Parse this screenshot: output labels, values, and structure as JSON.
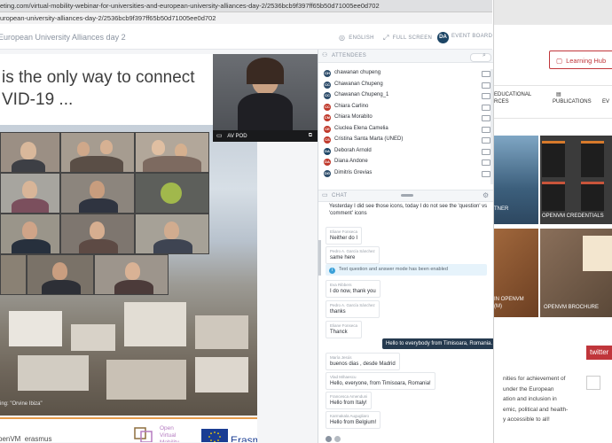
{
  "browser": {
    "url_line1": "eting.com/virtual-mobility-webinar-for-universities-and-european-university-alliances-day-2/2536bcb9f397ff65b50d71005ee0d702",
    "url_line2": "uropean-university-alliances-day-2/2536bcb9f397ff65b50d71005ee0d702"
  },
  "topbar": {
    "event_title": "European University Alliances day 2",
    "english": "ENGLISH",
    "full_screen": "FULL SCREEN",
    "avatar_initials": "DA",
    "event_board": "EVENT BOARD"
  },
  "slide": {
    "title_line1": "is the only way to connect",
    "title_line2": "VID-19 ...",
    "caption": "ing: \"Orvine Ibiza\"",
    "handle": "penVM_erasmus",
    "logo_text": "Open\nVirtual\nMobility",
    "erasmus": "Erasmus+"
  },
  "avpod": {
    "label": "AV POD"
  },
  "attendees": {
    "title": "ATTENDEES",
    "list": [
      {
        "initials": "CH",
        "name": "chawanan chupeng",
        "color": "#2e4d6b"
      },
      {
        "initials": "CC",
        "name": "Chawanan Chupeng",
        "color": "#2e4d6b"
      },
      {
        "initials": "CC",
        "name": "Chawanan Chupeng_1",
        "color": "#2e4d6b"
      },
      {
        "initials": "CC",
        "name": "Chiara Carlino",
        "color": "#c0392b"
      },
      {
        "initials": "CM",
        "name": "Chiara Morabito",
        "color": "#c0392b"
      },
      {
        "initials": "CE",
        "name": "Ciuclea Elena Camelia",
        "color": "#c0392b"
      },
      {
        "initials": "CS",
        "name": "Cristina Santa Marta (UNED)",
        "color": "#c0392b"
      },
      {
        "initials": "DA",
        "name": "Deborah Arnold",
        "color": "#1c4565"
      },
      {
        "initials": "DA",
        "name": "Diana Andone",
        "color": "#c0392b"
      },
      {
        "initials": "DG",
        "name": "Dimitris Grevias",
        "color": "#2e4d6b"
      }
    ]
  },
  "chat": {
    "title": "CHAT",
    "messages": [
      {
        "who": "",
        "text": "Yesterday I did see those icons, today I do not see the 'question' vs"
      },
      {
        "who": "",
        "text": "'comment' icons"
      },
      {
        "who": "Eliane Fonseca",
        "text": "Neither do I"
      },
      {
        "who": "Pedro A. García Sánchez",
        "text": "same here"
      },
      {
        "who": "Eva Ribbers",
        "text": "I do now, thank you"
      },
      {
        "who": "Pedro A. García Sánchez",
        "text": "thanks"
      },
      {
        "who": "Eliane Fonseca",
        "text": "Thanck"
      },
      {
        "who": "María Jesús",
        "text": "buenos dias , desde Madrid"
      },
      {
        "who": "Vlad Mihaescu",
        "text": "Hello, everyone, from Timisoara, Romania!"
      },
      {
        "who": "Francesca Amenduni",
        "text": "Hello from Italy!"
      },
      {
        "who": "Karmakala Augugliaro",
        "text": "Hello from Belgium!"
      }
    ],
    "system": "Text question and answer mode has been enabled",
    "own_message": "Hello to everybody from Timisoara, Romania."
  },
  "background_page": {
    "learning_hub": "Learning Hub",
    "nav_educational": "EDUCATIONAL\nRCES",
    "nav_publications": "PUBLICATIONS",
    "nav_ev": "EV",
    "card1": "TNER",
    "card2": "OPENVM CREDENTIALS",
    "card3": "IN OPENVM\n(M)",
    "card4": "OPENVM BROCHURE",
    "twitter": "twitter",
    "body_text": "nities for achievement of\nunder the European\nation and inclusion in\nemic, political and health-\ny accessible to all!"
  },
  "colors": {
    "accent": "#1c4565",
    "brand_red": "#c0363b",
    "chat_own": "#253a4f"
  }
}
